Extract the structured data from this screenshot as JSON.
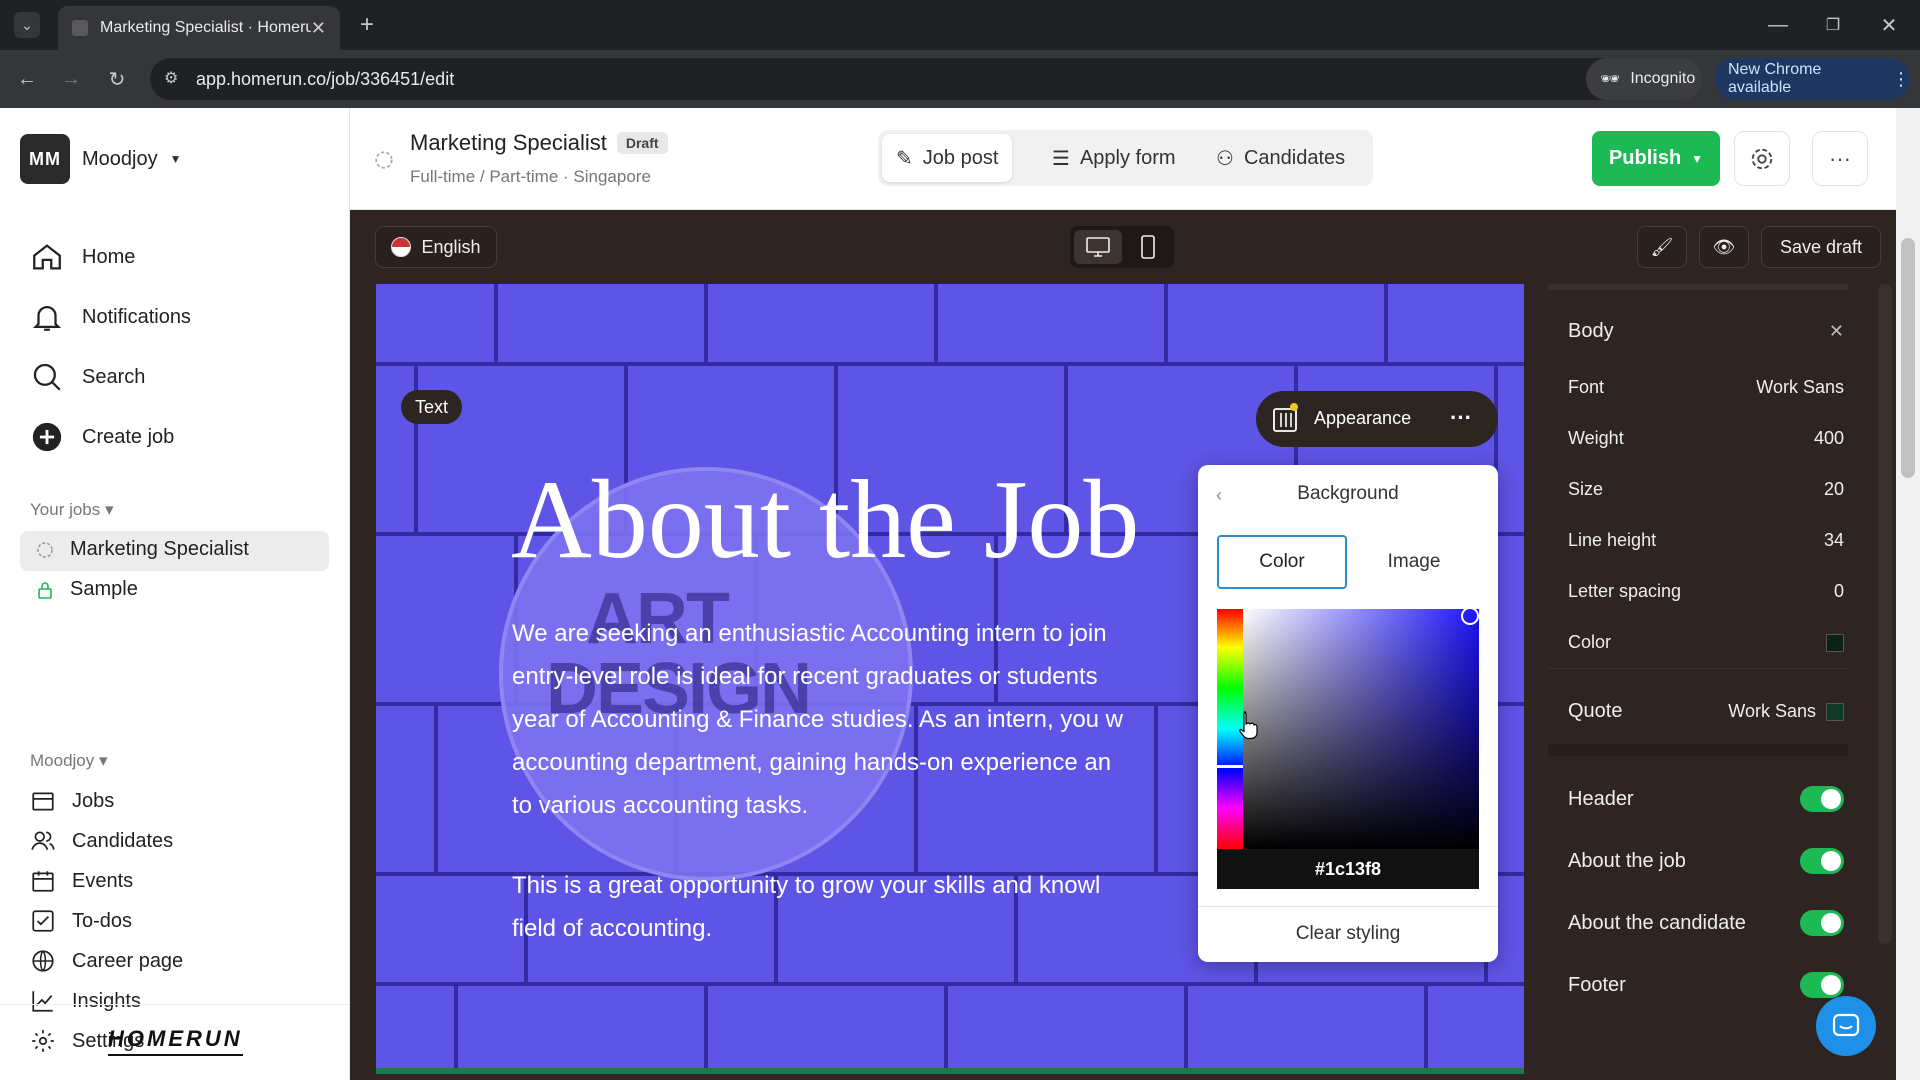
{
  "browser": {
    "tab_title": "Marketing Specialist · Homerun",
    "url": "app.homerun.co/job/336451/edit",
    "incognito_label": "Incognito",
    "new_chrome_label": "New Chrome available"
  },
  "sidebar": {
    "avatar_initials": "MM",
    "workspace": "Moodjoy",
    "nav": [
      {
        "label": "Home",
        "icon": "home-icon"
      },
      {
        "label": "Notifications",
        "icon": "bell-icon"
      },
      {
        "label": "Search",
        "icon": "search-icon"
      },
      {
        "label": "Create job",
        "icon": "plus-circle-icon"
      }
    ],
    "your_jobs_label": "Your jobs",
    "jobs": [
      {
        "label": "Marketing Specialist",
        "icon": "draft-circle-icon",
        "active": true
      },
      {
        "label": "Sample",
        "icon": "lock-icon",
        "active": false
      }
    ],
    "company_label": "Moodjoy",
    "company_nav": [
      {
        "label": "Jobs",
        "icon": "jobs-icon"
      },
      {
        "label": "Candidates",
        "icon": "candidates-icon"
      },
      {
        "label": "Events",
        "icon": "calendar-icon"
      },
      {
        "label": "To-dos",
        "icon": "checkbox-icon"
      },
      {
        "label": "Career page",
        "icon": "globe-icon"
      },
      {
        "label": "Insights",
        "icon": "chart-icon"
      },
      {
        "label": "Settings",
        "icon": "gear-icon"
      }
    ],
    "logo": "HOMERUN"
  },
  "header": {
    "job_title": "Marketing Specialist",
    "status_badge": "Draft",
    "subtitle": "Full-time / Part-time · Singapore",
    "tabs": [
      {
        "label": "Job post",
        "active": true
      },
      {
        "label": "Apply form",
        "active": false
      },
      {
        "label": "Candidates",
        "active": false
      }
    ],
    "publish_label": "Publish"
  },
  "toolbar": {
    "language": "English",
    "save_draft": "Save draft"
  },
  "canvas": {
    "block_label": "Text",
    "appearance_label": "Appearance",
    "heading": "About the Job",
    "paragraph1_lines": [
      "We are seeking an enthusiastic Accounting intern to join",
      "entry-level role is ideal for recent graduates or students",
      "year of Accounting & Finance studies. As an intern, you w",
      "accounting department, gaining hands-on experience an",
      "to various accounting tasks."
    ],
    "paragraph2_lines": [
      "This is a great opportunity to grow your skills and knowl",
      "field of accounting."
    ],
    "bg_sign_lines": [
      "ART",
      "DESIGN"
    ]
  },
  "popup": {
    "title": "Background",
    "tabs": [
      "Color",
      "Image"
    ],
    "active_tab": "Color",
    "hex": "#1c13f8",
    "clear_label": "Clear styling",
    "selected_color": "#1c13f8"
  },
  "panel": {
    "section_title": "Body",
    "props": [
      {
        "label": "Font",
        "value": "Work Sans"
      },
      {
        "label": "Weight",
        "value": "400"
      },
      {
        "label": "Size",
        "value": "20"
      },
      {
        "label": "Line height",
        "value": "34"
      },
      {
        "label": "Letter spacing",
        "value": "0"
      },
      {
        "label": "Color",
        "value": ""
      }
    ],
    "quote_label": "Quote",
    "quote_font": "Work Sans",
    "sections": [
      {
        "label": "Header",
        "on": true
      },
      {
        "label": "About the job",
        "on": true
      },
      {
        "label": "About the candidate",
        "on": true
      },
      {
        "label": "Footer",
        "on": true
      }
    ]
  },
  "colors": {
    "accent_green": "#1db954",
    "canvas_bg": "#5e54e6",
    "editor_bg": "#2f2623"
  }
}
